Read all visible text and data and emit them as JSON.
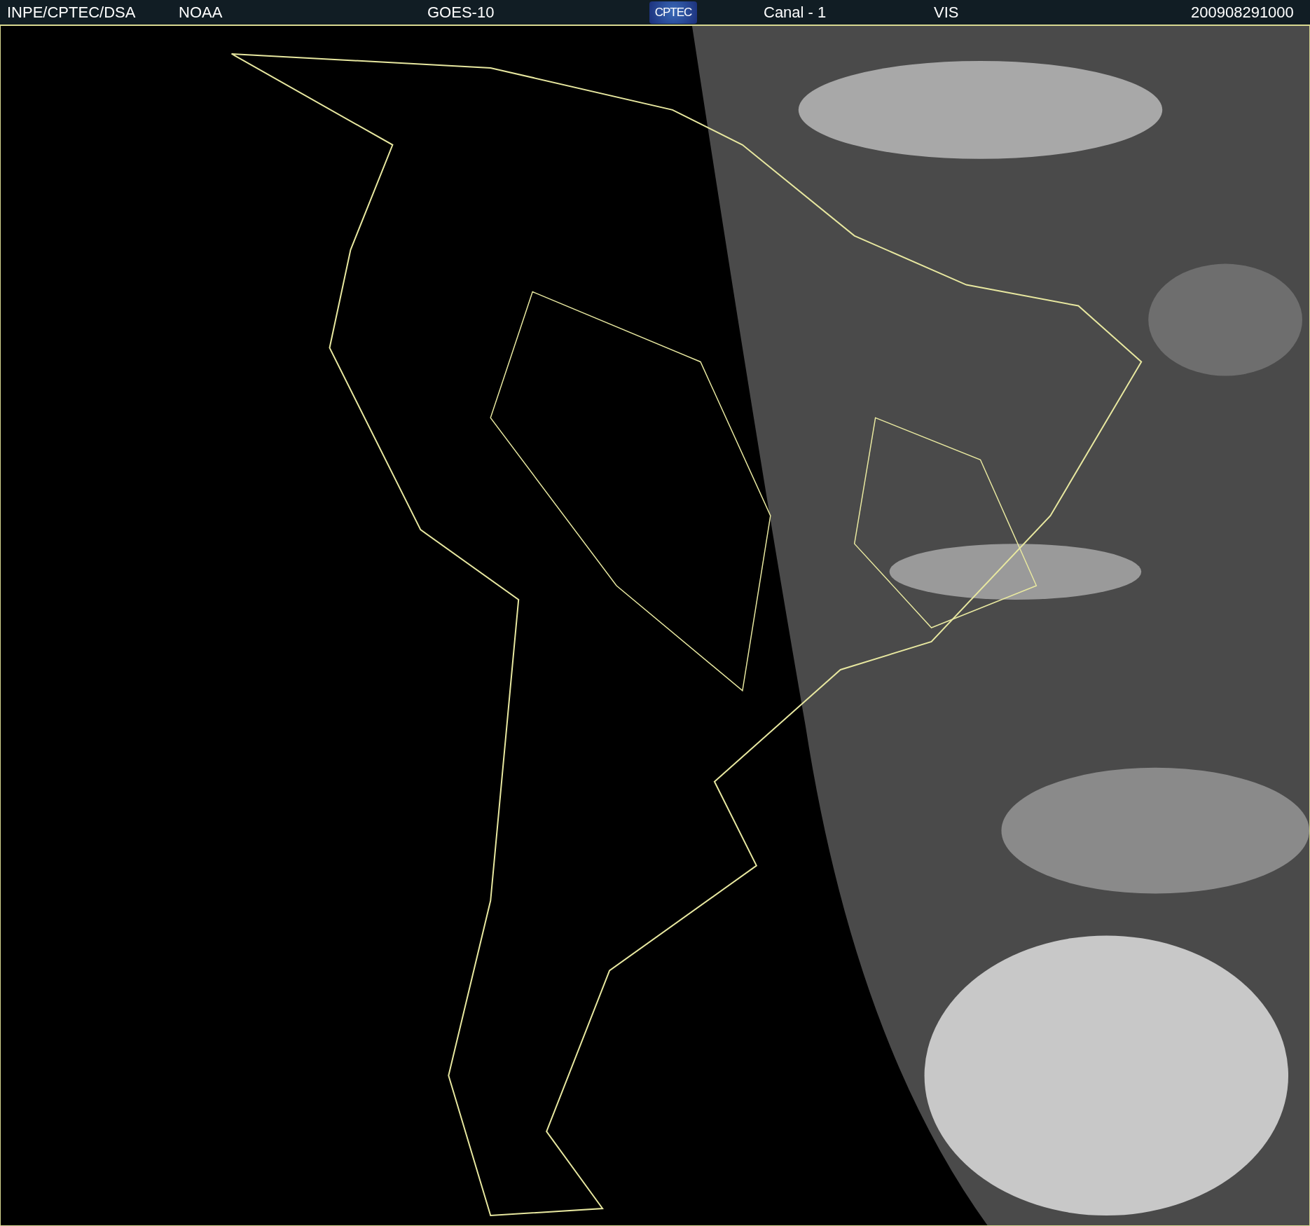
{
  "header": {
    "source": "INPE/CPTEC/DSA",
    "agency": "NOAA",
    "satellite": "GOES-10",
    "logo": "CPTEC",
    "channel": "Canal - 1",
    "band": "VIS",
    "timestamp": "200908291000"
  }
}
